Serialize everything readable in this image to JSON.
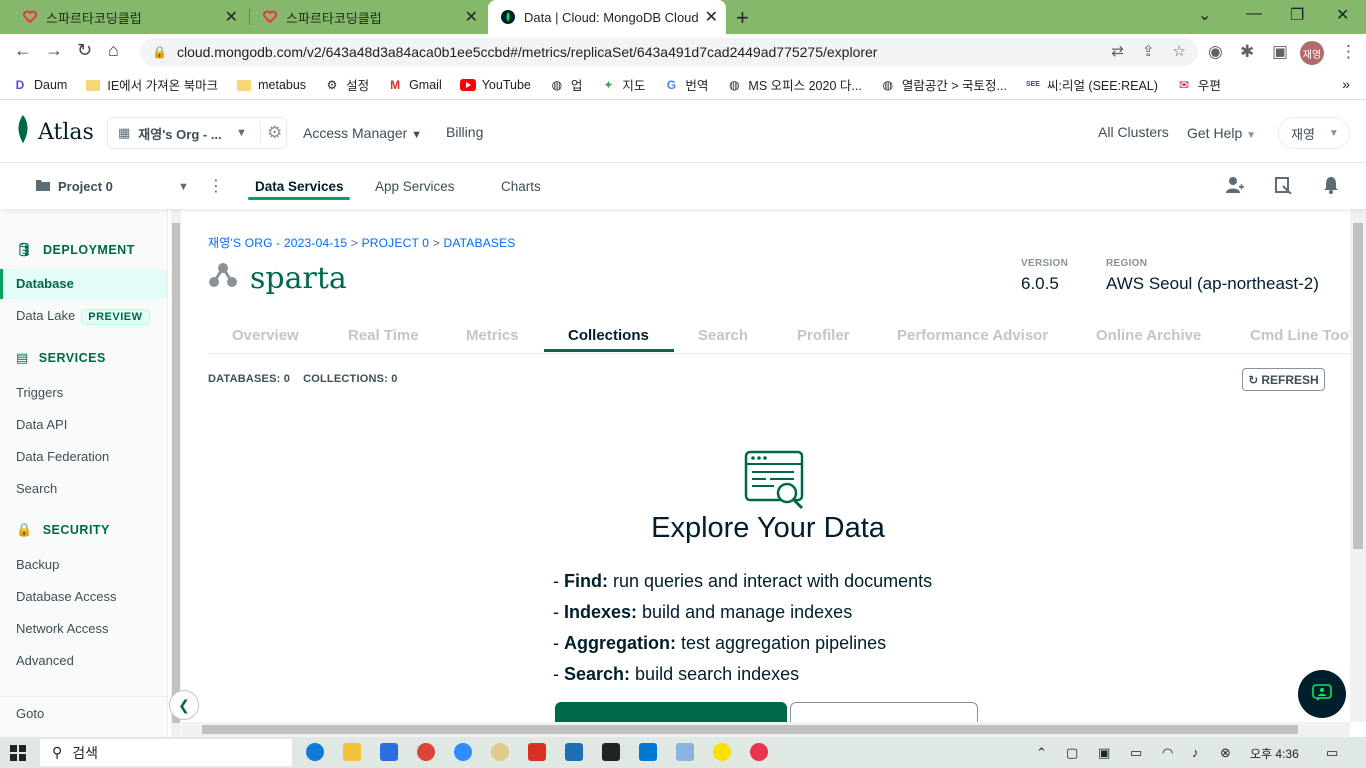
{
  "browser": {
    "tabs": [
      {
        "title": "스파르타코딩클럽"
      },
      {
        "title": "스파르타코딩클럽"
      },
      {
        "title": "Data | Cloud: MongoDB Cloud"
      }
    ],
    "url": "cloud.mongodb.com/v2/643a48d3a84aca0b1ee5ccbd#/metrics/replicaSet/643a491d7cad2449ad775275/explorer",
    "profile_initials": "재영",
    "bookmarks": [
      {
        "label": "Daum"
      },
      {
        "label": "IE에서 가져온 북마크"
      },
      {
        "label": "metabus"
      },
      {
        "label": "설정"
      },
      {
        "label": "Gmail"
      },
      {
        "label": "YouTube"
      },
      {
        "label": "업"
      },
      {
        "label": "지도"
      },
      {
        "label": "번역"
      },
      {
        "label": "MS 오피스 2020 다..."
      },
      {
        "label": "열람공간 > 국토정..."
      },
      {
        "label": "씨:리얼 (SEE:REAL)"
      },
      {
        "label": "우편"
      }
    ]
  },
  "atlas": {
    "logo_text": "Atlas",
    "org_name": "재영's Org - ...",
    "nav": {
      "access_manager": "Access Manager",
      "billing": "Billing",
      "all_clusters": "All Clusters",
      "get_help": "Get Help",
      "user": "재영"
    },
    "project": {
      "name": "Project 0",
      "services": [
        "Data Services",
        "App Services",
        "Charts"
      ]
    },
    "sidebar": {
      "deployment_heading": "DEPLOYMENT",
      "database": "Database",
      "data_lake": "Data Lake",
      "preview_badge": "PREVIEW",
      "services_heading": "SERVICES",
      "triggers": "Triggers",
      "data_api": "Data API",
      "data_federation": "Data Federation",
      "search": "Search",
      "security_heading": "SECURITY",
      "backup": "Backup",
      "database_access": "Database Access",
      "network_access": "Network Access",
      "advanced": "Advanced",
      "goto": "Goto"
    },
    "breadcrumb": {
      "org": "재영'S ORG - 2023-04-15",
      "project": "PROJECT 0",
      "section": "DATABASES",
      "sep": " > "
    },
    "cluster": {
      "name": "sparta",
      "version_label": "VERSION",
      "version": "6.0.5",
      "region_label": "REGION",
      "region": "AWS Seoul (ap-northeast-2)"
    },
    "tabs": [
      "Overview",
      "Real Time",
      "Metrics",
      "Collections",
      "Search",
      "Profiler",
      "Performance Advisor",
      "Online Archive",
      "Cmd Line Tools"
    ],
    "counts": {
      "databases_label": "DATABASES:",
      "databases": "0",
      "collections_label": "COLLECTIONS:",
      "collections": "0"
    },
    "refresh_label": "REFRESH",
    "explore": {
      "title": "Explore Your Data",
      "items": [
        {
          "bold": "Find:",
          "text": " run queries and interact with documents"
        },
        {
          "bold": "Indexes:",
          "text": " build and manage indexes"
        },
        {
          "bold": "Aggregation:",
          "text": " test aggregation pipelines"
        },
        {
          "bold": "Search:",
          "text": " build search indexes"
        }
      ]
    }
  },
  "taskbar": {
    "search_placeholder": "검색",
    "time": "오후 4:36"
  }
}
